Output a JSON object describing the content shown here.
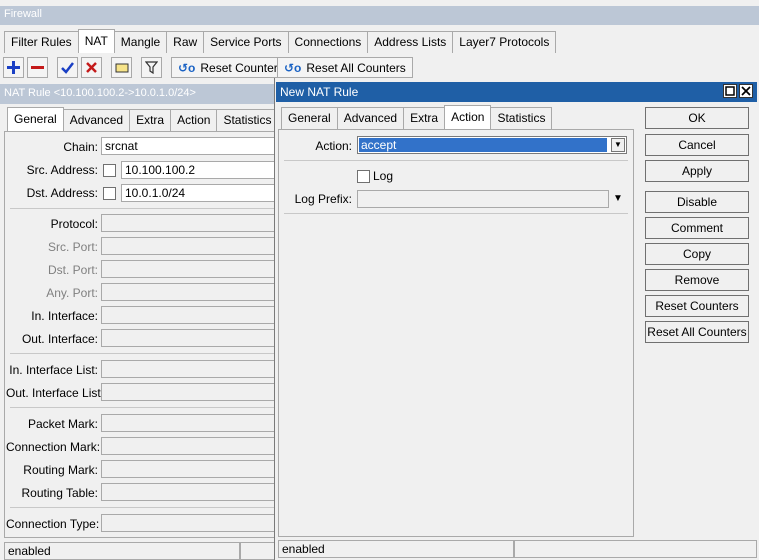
{
  "firewall": {
    "title": "Firewall",
    "tabs": [
      "Filter Rules",
      "NAT",
      "Mangle",
      "Raw",
      "Service Ports",
      "Connections",
      "Address Lists",
      "Layer7 Protocols"
    ],
    "toolbar": {
      "reset_counters": "Reset Counters",
      "reset_all_counters": "Reset All Counters"
    }
  },
  "nat_rule": {
    "title": "NAT Rule <10.100.100.2->10.0.1.0/24>",
    "tabs": [
      "General",
      "Advanced",
      "Extra",
      "Action",
      "Statistics"
    ],
    "chain_label": "Chain:",
    "chain_value": "srcnat",
    "src_address_label": "Src. Address:",
    "src_address_value": "10.100.100.2",
    "dst_address_label": "Dst. Address:",
    "dst_address_value": "10.0.1.0/24",
    "protocol_label": "Protocol:",
    "src_port_label": "Src. Port:",
    "dst_port_label": "Dst. Port:",
    "any_port_label": "Any. Port:",
    "in_interface_label": "In. Interface:",
    "out_interface_label": "Out. Interface:",
    "in_interface_list_label": "In. Interface List:",
    "out_interface_list_label": "Out. Interface List:",
    "packet_mark_label": "Packet Mark:",
    "connection_mark_label": "Connection Mark:",
    "routing_mark_label": "Routing Mark:",
    "routing_table_label": "Routing Table:",
    "connection_type_label": "Connection Type:",
    "status": "enabled"
  },
  "new_nat_rule": {
    "title": "New NAT Rule",
    "tabs": [
      "General",
      "Advanced",
      "Extra",
      "Action",
      "Statistics"
    ],
    "action_label": "Action:",
    "action_value": "accept",
    "log_label": "Log",
    "log_prefix_label": "Log Prefix:",
    "buttons": [
      "OK",
      "Cancel",
      "Apply",
      "Disable",
      "Comment",
      "Copy",
      "Remove",
      "Reset Counters",
      "Reset All Counters"
    ],
    "status": "enabled"
  }
}
